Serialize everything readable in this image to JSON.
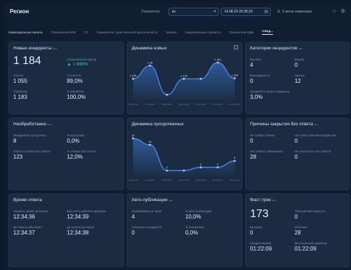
{
  "header": {
    "title": "Регион",
    "period_label": "Показатель",
    "select_value": "вс",
    "date_range": "14.08.23-20.08.23",
    "nav_menu": "К меню навигации"
  },
  "tabs": [
    "Навигационная панель",
    "Показатели МЗК",
    "ТС",
    "Показатели туристической деятельности",
    "Экопро",
    "Национальные проекты",
    "Показатели КДМ",
    "Свод..."
  ],
  "cards": {
    "new_incidents": {
      "title": "Новые инциденты",
      "hint": "шт.",
      "total": "1 184",
      "compare_label": "к показателей недели",
      "compare_value": "▲ > 999%",
      "answers_label": "Ответы",
      "answers_value": "1 055",
      "answers_pct_label": "% ответов",
      "answers_pct_value": "89,0%",
      "worked_label": "Отработку",
      "worked_value": "1 183",
      "worked_pct_label": "% отработки",
      "worked_pct_value": "100,0%"
    },
    "dynamics_new": {
      "title": "Динамика новых"
    },
    "categories": {
      "title": "Категории инцидентов",
      "hint": "шт.",
      "complaint_label": "Жалоба",
      "complaint_value": "4",
      "question_label": "Вопрос",
      "question_value": "0",
      "gratitude_label": "Благодарность",
      "gratitude_value": "0",
      "other_label": "Прочее",
      "other_value": "12",
      "share_label": "Средний % лично созданных",
      "share_value": "3,0%"
    },
    "unprocessed": {
      "title": "Необработанно",
      "hint": "шт.",
      "overdue_label": "Инцидентов просрочено",
      "overdue_value": "8",
      "overdue_pct_label": "% просрочки",
      "overdue_pct_value": "0,0%",
      "ready_label": "Ответы готовые без ответа",
      "ready_value": "123",
      "ready_pct_label": "% готовых без ответа",
      "ready_pct_value": "12,0%"
    },
    "dynamics_overdue": {
      "title": "Динамика просроченных"
    },
    "close_reasons": {
      "title": "Причины закрытия без ответа",
      "hint": "шт.",
      "no_answer_label": "Не требует ответа",
      "no_answer_value": "0",
      "no_responsible_label": "Нет ответственного ведомства",
      "no_responsible_value": "0",
      "impossible_label": "Нет ответа, невозможно",
      "impossible_value": "28",
      "not_related_label": "Не относится к зон. власти",
      "not_related_value": "0"
    },
    "response_time": {
      "title": "Время ответа",
      "avg_label": "Среднее время до ответа",
      "avg_value": "12:34:36",
      "all_label": "Все учета рабочего времени",
      "all_value": "12:34:39",
      "to_answer_label": "До ответа (обычные)",
      "to_answer_value": "12:34:37",
      "to_answer2_label": "До ответа (высокие)",
      "to_answer2_value": "12:34:38"
    },
    "auto_publish": {
      "title": "Авто-публикации",
      "hint": "шт.",
      "published_label": "Опубликовано в чатах",
      "published_value": "4",
      "published_pct_label": "% авто-публикаций",
      "published_pct_value": "10,0%",
      "declined_label": "Отказано в инциденте",
      "declined_value": "0",
      "declined_pct_label": "% отказанных",
      "declined_pct_value": "0,0%"
    },
    "fast_track": {
      "title": "Фаст-трек",
      "hint": "шт.",
      "total": "173",
      "relevance_label": "Повышенная важность",
      "relevance_value": "0",
      "high_label": "Высокая",
      "high_value": "0",
      "normal_label": "Обычная",
      "normal_value": "28",
      "avg_time_label": "Среднее время",
      "avg_time_value": "01:22:09",
      "all_time_label": "Без учета раб. времени",
      "all_time_value": "01:22:09"
    }
  },
  "chart_data": [
    {
      "type": "line",
      "title": "Динамика новых",
      "x": [
        "17.08-17.07",
        "17.07-18.07",
        "18.07-19.07",
        "19.07-20.07",
        "20.07-21.07",
        "21.07-22.07",
        "22.07-23.07"
      ],
      "values": [
        1155,
        1960,
        175,
        1151,
        1151,
        2151,
        1184
      ],
      "labels": [
        "1 155",
        "1 96",
        "",
        "1 175",
        "",
        "2 151",
        "1 184"
      ]
    },
    {
      "type": "line",
      "title": "Динамика просроченных",
      "x": [
        "17.08-17.07",
        "17.07-18.07",
        "18.07-19.07",
        "19.07-20.07",
        "20.07-21.07",
        "21.07-22.07",
        "22.07-23.07"
      ],
      "values": [
        12,
        10,
        2,
        2,
        3,
        3,
        5
      ],
      "labels": [
        "12",
        "10",
        "2",
        "",
        "3",
        "3",
        "5"
      ]
    }
  ],
  "colors": {
    "background": "#0f1e31",
    "card": "#1b2c42",
    "accent_line": "#3f7fe0",
    "positive": "#35d17c"
  }
}
